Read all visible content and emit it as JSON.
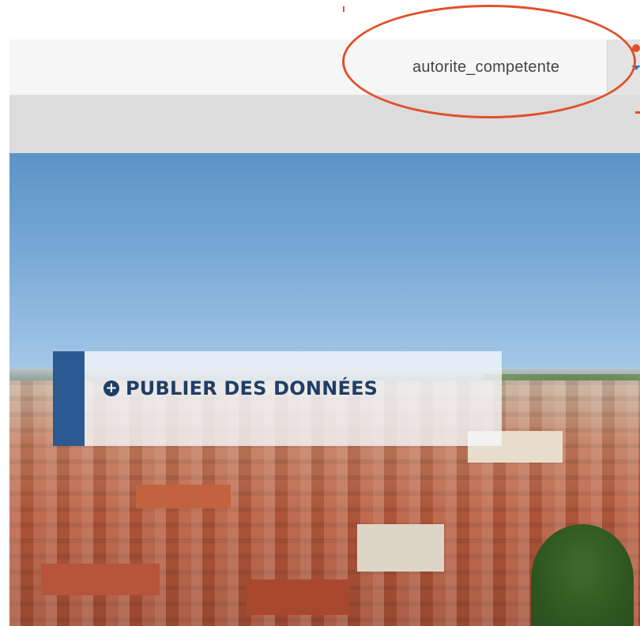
{
  "header": {
    "username": "autorite_competente"
  },
  "hero": {
    "publish_label": "PUBLIER DES DONNÉES"
  },
  "icons": {
    "dropdown": "caret-down-icon",
    "publish": "plus-circle-icon"
  },
  "colors": {
    "accent_blue": "#2b5a93",
    "annotation_red": "#e0502a",
    "publish_text": "#1f3e67"
  }
}
